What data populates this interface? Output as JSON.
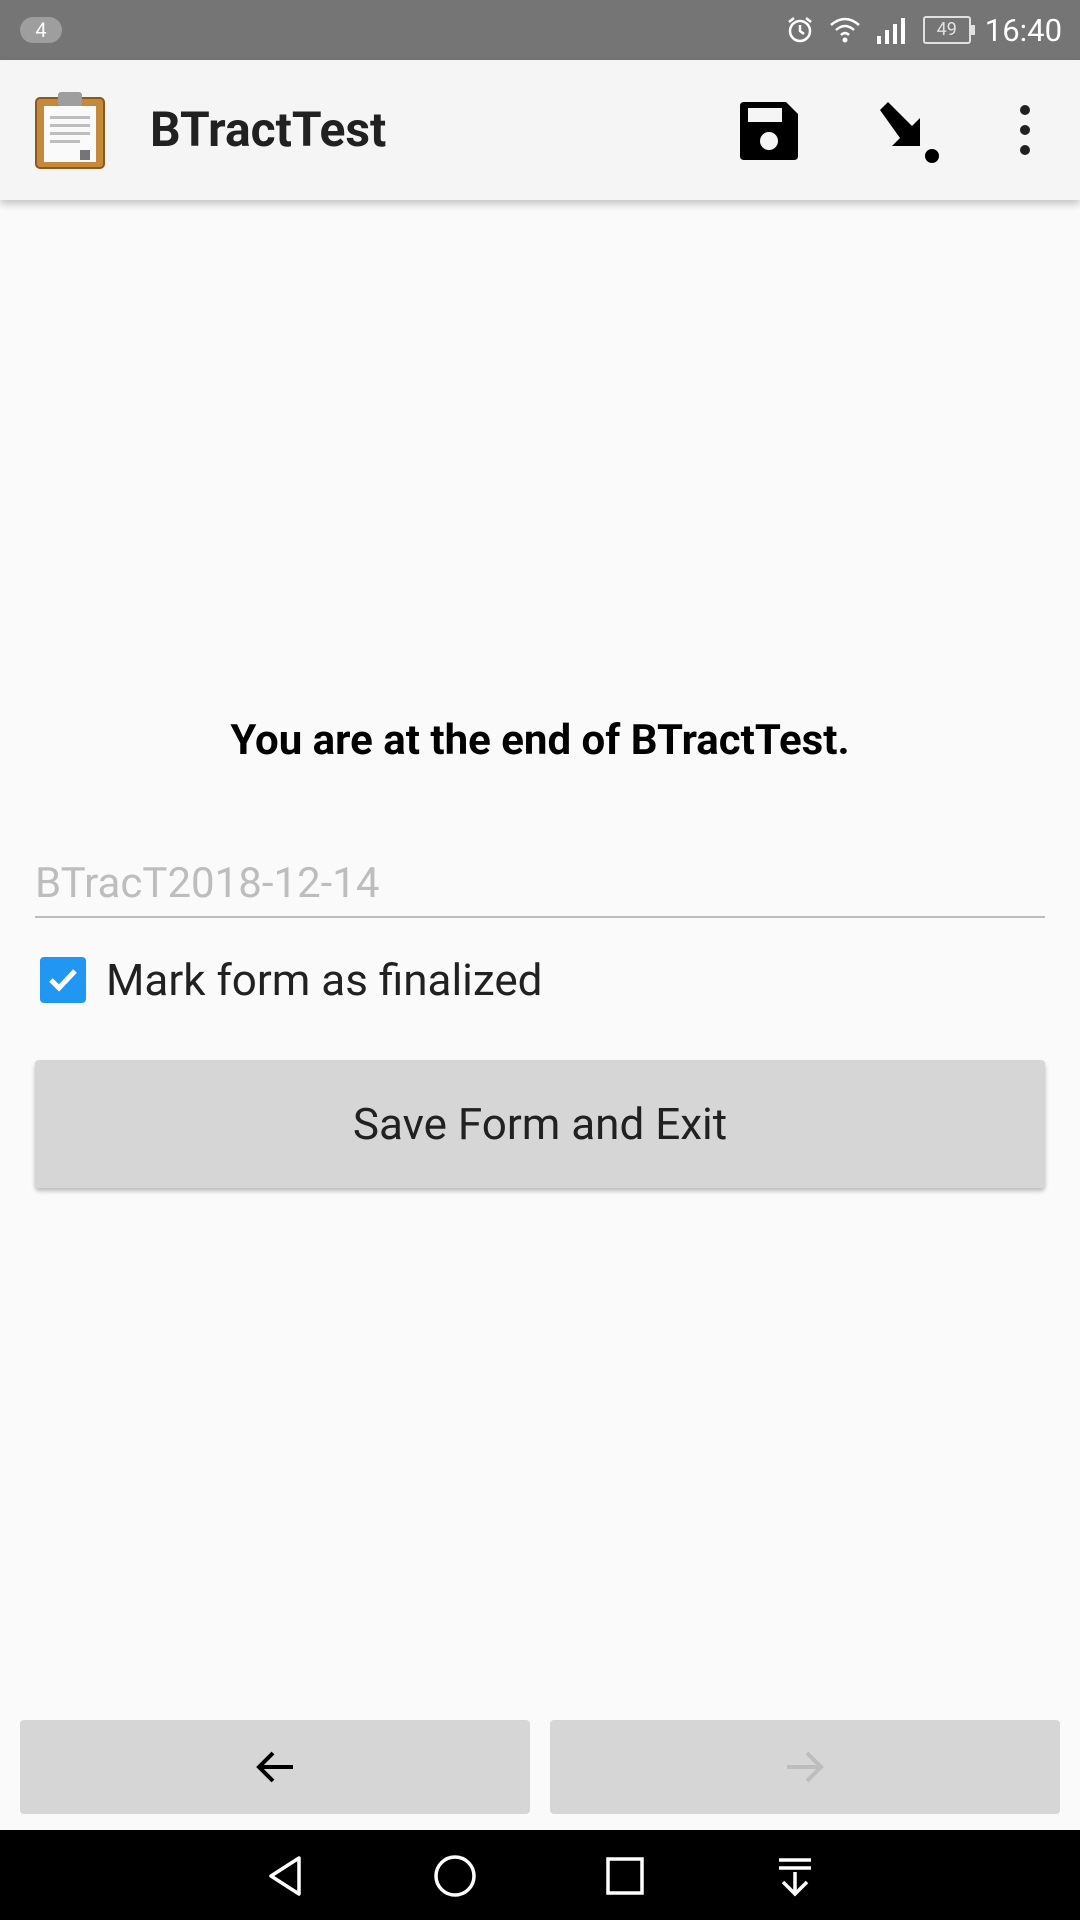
{
  "status_bar": {
    "notification_count": "4",
    "battery": "49",
    "time": "16:40",
    "icons": [
      "alarm-icon",
      "wifi-icon",
      "signal-icon",
      "battery-icon"
    ]
  },
  "app_bar": {
    "title": "BTractTest",
    "icons": [
      "clipboard-app-icon",
      "save-icon",
      "jump-to-icon",
      "more-vert-icon"
    ]
  },
  "content": {
    "end_message": "You are at the end of BTractTest.",
    "instance_name_placeholder": "BTracT2018-12-14",
    "finalize_label": "Mark form as finalized",
    "finalize_checked": true,
    "save_button_label": "Save Form and Exit"
  },
  "navigation": {
    "back_icon": "arrow-back-icon",
    "forward_icon": "arrow-forward-icon",
    "forward_disabled": true
  },
  "system_nav": {
    "icons": [
      "back-triangle-icon",
      "home-circle-icon",
      "recents-square-icon",
      "notification-pull-icon"
    ]
  },
  "colors": {
    "accent": "#2196f3",
    "status_bar": "#757575",
    "app_bar": "#f5f5f5",
    "button": "#d6d6d6"
  }
}
